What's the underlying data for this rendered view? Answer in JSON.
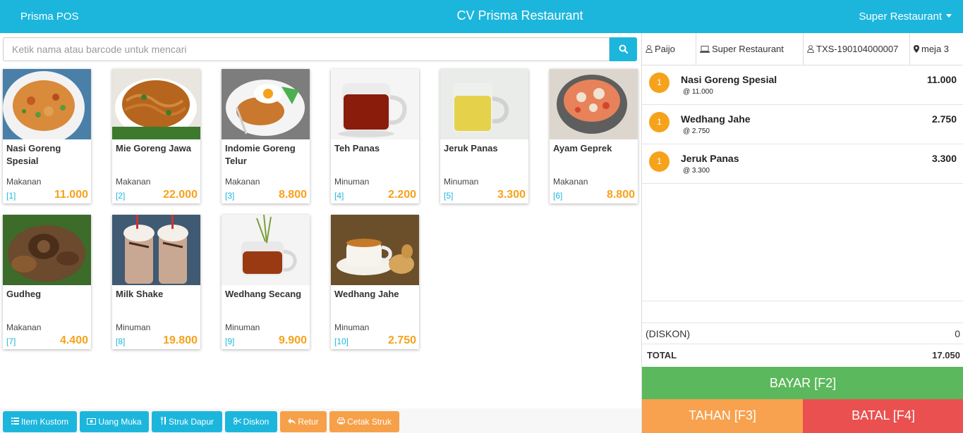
{
  "header": {
    "brand": "Prisma POS",
    "title": "CV Prisma Restaurant",
    "user_menu": "Super Restaurant"
  },
  "search": {
    "placeholder": "Ketik nama atau barcode untuk mencari"
  },
  "products": [
    {
      "name": "Nasi Goreng Spesial",
      "category": "Makanan",
      "code": "[1]",
      "price": "11.000"
    },
    {
      "name": "Mie Goreng Jawa",
      "category": "Makanan",
      "code": "[2]",
      "price": "22.000"
    },
    {
      "name": "Indomie Goreng Telur",
      "category": "Makanan",
      "code": "[3]",
      "price": "8.800"
    },
    {
      "name": "Teh Panas",
      "category": "Minuman",
      "code": "[4]",
      "price": "2.200"
    },
    {
      "name": "Jeruk Panas",
      "category": "Minuman",
      "code": "[5]",
      "price": "3.300"
    },
    {
      "name": "Ayam Geprek",
      "category": "Makanan",
      "code": "[6]",
      "price": "8.800"
    },
    {
      "name": "Gudheg",
      "category": "Makanan",
      "code": "[7]",
      "price": "4.400"
    },
    {
      "name": "Milk Shake",
      "category": "Minuman",
      "code": "[8]",
      "price": "19.800"
    },
    {
      "name": "Wedhang Secang",
      "category": "Minuman",
      "code": "[9]",
      "price": "9.900"
    },
    {
      "name": "Wedhang Jahe",
      "category": "Minuman",
      "code": "[10]",
      "price": "2.750"
    }
  ],
  "actions": {
    "item_kustom": "Item Kustom",
    "uang_muka": "Uang Muka",
    "struk_dapur": "Struk Dapur",
    "diskon": "Diskon",
    "retur": "Retur",
    "cetak_struk": "Cetak Struk"
  },
  "info": {
    "user": "Paijo",
    "outlet": "Super Restaurant",
    "transaction": "TXS-190104000007",
    "table": "meja 3"
  },
  "orders": [
    {
      "qty": "1",
      "name": "Nasi Goreng Spesial",
      "unit_price": "@ 11.000",
      "total": "11.000"
    },
    {
      "qty": "1",
      "name": "Wedhang Jahe",
      "unit_price": "@ 2.750",
      "total": "2.750"
    },
    {
      "qty": "1",
      "name": "Jeruk Panas",
      "unit_price": "@ 3.300",
      "total": "3.300"
    }
  ],
  "summary": {
    "discount_label": "(DISKON)",
    "discount_value": "0",
    "total_label": "TOTAL",
    "total_value": "17.050"
  },
  "buttons": {
    "pay": "BAYAR [F2]",
    "hold": "TAHAN [F3]",
    "cancel": "BATAL [F4]"
  },
  "colors": {
    "primary": "#1cb6dd",
    "price": "#f7a21b",
    "pay": "#5cb85c",
    "hold": "#f8a14e",
    "cancel": "#e9504f"
  }
}
